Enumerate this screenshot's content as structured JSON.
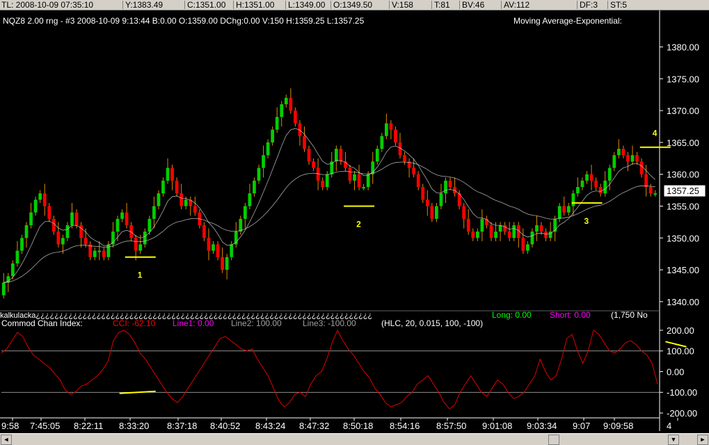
{
  "status_bar": {
    "items": [
      "TL: 2008-10-09  07:35:10",
      "Y:1383.49",
      "C:1351.00",
      "H:1351.00",
      "L:1349.00",
      "O:1349.50",
      "V:158",
      "T:81",
      "BV:46",
      "AV:112",
      "DF:3",
      "ST:5"
    ]
  },
  "price_panel": {
    "header": "NQZ8  2.00 rng - #3  2008-10-09  9:13:44  B:0.00  O:1359.00  DChg:0.00  V:150  H:1359.25  L:1357.25",
    "indicator_label": "Moving Average-Exponential:",
    "current_price": "1357.25"
  },
  "cci_panel": {
    "divider_text": "kalkulacka¿¿¿¿¿¿¿¿¿¿¿¿¿¿¿¿¿¿¿¿¿¿¿¿¿¿¿¿¿¿¿¿¿¿¿¿¿¿¿¿¿¿¿¿¿¿¿¿¿¿¿¿¿¿¿¿¿¿¿¿¿¿¿¿¿¿¿¿¿¿¿¿",
    "long_label": "Long: 0.00",
    "short_label": "Short: 0.00",
    "extra_label": "(1,750  No",
    "title": "Commod Chan Index:",
    "cci_value": "CCI: -62.10",
    "line1": "Line1: 0.00",
    "line2": "Line2: 100.00",
    "line3": "Line3: -100.00",
    "params": "(HLC, 20, 0.015, 100, -100)"
  },
  "bottom_bar": {
    "left_arrow": "◄",
    "right_arrow": "►",
    "extra_button": "▼"
  },
  "colors": {
    "up": "#00d000",
    "down": "#ff0000",
    "wick": "#e08a00",
    "ema_fast": "#c8c8c8",
    "ema_slow": "#c8c8c8",
    "cci": "#e00000",
    "annotation": "#ffff00",
    "text": "#ffffff"
  },
  "chart_data": [
    {
      "type": "candlestick",
      "title": "NQZ8 2.00 rng - #3",
      "y_ticks": [
        1340,
        1345,
        1350,
        1355,
        1360,
        1365,
        1370,
        1375,
        1380
      ],
      "ylim": [
        1339,
        1383
      ],
      "x_ticks": [
        "9:58",
        "7:45:05",
        "8:22:11",
        "8:33:20",
        "8:37:18",
        "8:40:52",
        "8:43:24",
        "8:47:32",
        "8:50:18",
        "8:54:16",
        "8:57:50",
        "9:01:08",
        "9:03:34",
        "9:07",
        "9:09:58",
        "4"
      ],
      "bar_count": 190,
      "closes": [
        1343,
        1344,
        1346,
        1348,
        1350,
        1352,
        1354,
        1356,
        1357,
        1355,
        1353,
        1351,
        1349,
        1350,
        1352,
        1354,
        1352,
        1350,
        1349,
        1347,
        1348,
        1348,
        1347,
        1349,
        1351,
        1353,
        1354,
        1352,
        1350,
        1348,
        1349,
        1351,
        1353,
        1355,
        1357,
        1359,
        1361,
        1359,
        1357,
        1355,
        1356,
        1355,
        1354,
        1352,
        1350,
        1348,
        1349,
        1347,
        1345,
        1347,
        1349,
        1351,
        1353,
        1355,
        1357,
        1359,
        1361,
        1363,
        1365,
        1367,
        1369,
        1371,
        1372,
        1370,
        1368,
        1366,
        1364,
        1362,
        1361,
        1359,
        1358,
        1360,
        1362,
        1364,
        1362,
        1361,
        1359,
        1360,
        1358,
        1358,
        1360,
        1362,
        1364,
        1366,
        1368,
        1367,
        1365,
        1363,
        1362,
        1361,
        1360,
        1358,
        1356,
        1355,
        1353,
        1355,
        1357,
        1359,
        1358,
        1357,
        1355,
        1353,
        1351,
        1350,
        1351,
        1353,
        1352,
        1350,
        1351,
        1352,
        1351,
        1350,
        1352,
        1350,
        1348,
        1349,
        1351,
        1352,
        1351,
        1350,
        1351,
        1353,
        1355,
        1354,
        1355,
        1357,
        1358,
        1359,
        1360,
        1359,
        1358,
        1357,
        1359,
        1361,
        1363,
        1364,
        1363,
        1362,
        1363,
        1362,
        1360,
        1358,
        1357,
        1357
      ],
      "markers": [
        {
          "label": "1",
          "price": 1347.0
        },
        {
          "label": "2",
          "price": 1355.0
        },
        {
          "label": "3",
          "price": 1355.5
        },
        {
          "label": "4",
          "price": 1364.25
        }
      ],
      "series": [
        {
          "name": "EMA fast"
        },
        {
          "name": "EMA slow"
        }
      ]
    },
    {
      "type": "line",
      "title": "Commod Chan Index",
      "y_ticks": [
        -200,
        -100,
        0,
        100,
        200
      ],
      "ylim": [
        -200,
        210
      ],
      "levels": [
        100,
        -100
      ],
      "values": [
        90,
        110,
        150,
        190,
        170,
        120,
        80,
        60,
        40,
        20,
        -10,
        -40,
        -90,
        -110,
        -95,
        -70,
        -60,
        -40,
        -20,
        10,
        50,
        150,
        190,
        200,
        180,
        140,
        90,
        60,
        20,
        -20,
        -60,
        -100,
        -130,
        -150,
        -120,
        -80,
        -40,
        0,
        40,
        80,
        120,
        160,
        170,
        150,
        130,
        110,
        100,
        110,
        60,
        20,
        -20,
        -80,
        -140,
        -170,
        -150,
        -110,
        -100,
        -120,
        -60,
        -20,
        0,
        60,
        140,
        200,
        150,
        110,
        80,
        40,
        0,
        -30,
        -80,
        -110,
        -150,
        -170,
        -160,
        -150,
        -120,
        -100,
        -60,
        -40,
        -20,
        -60,
        -100,
        -150,
        -180,
        -160,
        -100,
        -60,
        -20,
        -60,
        -100,
        -120,
        -80,
        -40,
        -60,
        -100,
        -130,
        -120,
        -100,
        -60,
        -20,
        60,
        0,
        -40,
        -20,
        60,
        160,
        180,
        100,
        40,
        100,
        200,
        180,
        140,
        100,
        90,
        110,
        140,
        150,
        130,
        100,
        80,
        40,
        -60
      ]
    }
  ]
}
